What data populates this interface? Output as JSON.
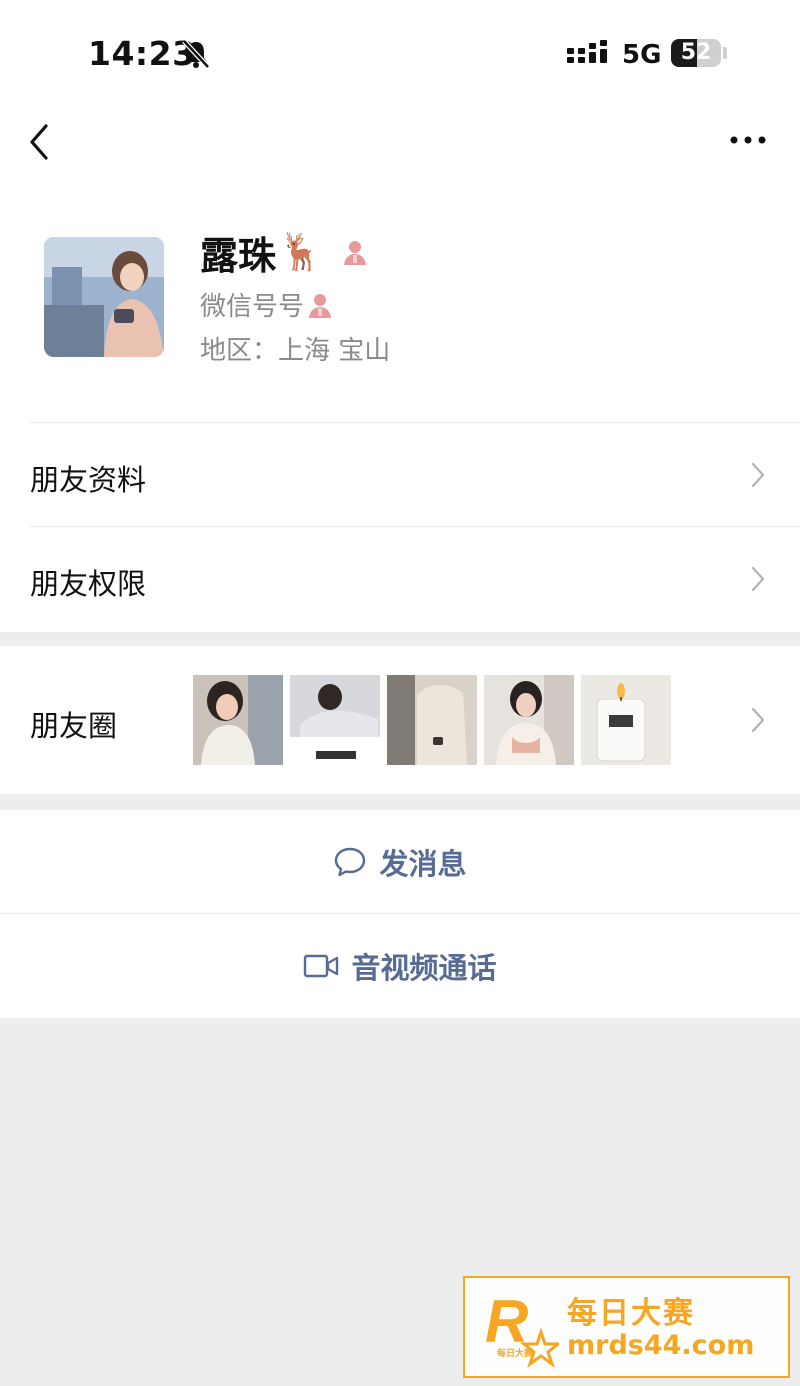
{
  "status": {
    "time": "14:23",
    "network": "5G",
    "battery": "52",
    "battery_level": 0.52
  },
  "nav": {
    "back_icon": "back-chevron-icon",
    "more_icon": "more-dots-icon"
  },
  "profile": {
    "nickname": "露珠",
    "nickname_emoji": "🦌",
    "wxid_label": "微信号号",
    "region": "地区：上海 宝山"
  },
  "menu": {
    "friend_info": "朋友资料",
    "friend_permissions": "朋友权限",
    "moments": "朋友圈"
  },
  "actions": {
    "message": "发消息",
    "video_call": "音视频通话"
  },
  "watermark": {
    "title": "每日大赛",
    "url": "mrds44.com",
    "logo_letter": "R",
    "logo_sub": "每日大赛"
  },
  "colors": {
    "link": "#576b95",
    "background": "#ededed",
    "card": "#ffffff",
    "watermark": "#f5a623"
  }
}
